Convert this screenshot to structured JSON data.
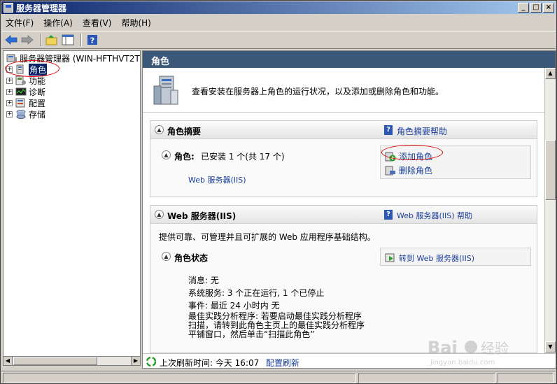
{
  "window": {
    "title": "服务器管理器"
  },
  "titlebar_buttons": [
    "_",
    "□",
    "×"
  ],
  "menu": [
    "文件(F)",
    "操作(A)",
    "查看(V)",
    "帮助(H)"
  ],
  "tree": {
    "root": "服务器管理器 (WIN-HFTHVT2TSE",
    "items": [
      {
        "label": "角色",
        "selected": true
      },
      {
        "label": "功能"
      },
      {
        "label": "诊断"
      },
      {
        "label": "配置"
      },
      {
        "label": "存储"
      }
    ]
  },
  "main": {
    "header": "角色",
    "intro": "查看安装在服务器上角色的运行状况，以及添加或删除角色和功能。",
    "summary": {
      "title": "角色摘要",
      "help": "角色摘要帮助",
      "roles_label": "角色:",
      "roles_value": "已安装 1 个(共 17 个)",
      "role_link": "Web 服务器(IIS)",
      "add": "添加角色",
      "remove": "删除角色"
    },
    "web": {
      "title": "Web 服务器(IIS)",
      "help": "Web 服务器(IIS) 帮助",
      "desc": "提供可靠、可管理并且可扩展的 Web 应用程序基础结构。",
      "status_title": "角色状态",
      "goto": "转到 Web 服务器(IIS)",
      "messages": "消息: 无",
      "services": "系统服务: 3 个正在运行, 1 个已停止",
      "events": "事件: 最近 24 小时内 无",
      "bpa_line1": "最佳实践分析程序: 若要启动最佳实践分析程序",
      "bpa_line2": "扫描，请转到此角色主页上的最佳实践分析程序",
      "bpa_line3": "平铺窗口，然后单击“扫描此角色”"
    },
    "status_bar": {
      "label": "上次刷新时间: 今天 16:07",
      "refresh": "配置刷新"
    }
  },
  "colors": {
    "header": "#3b5878",
    "link": "#1a3e9a",
    "annotation": "#dd0000"
  },
  "watermark": "Baidu 经验 jingyan.baidu.com"
}
